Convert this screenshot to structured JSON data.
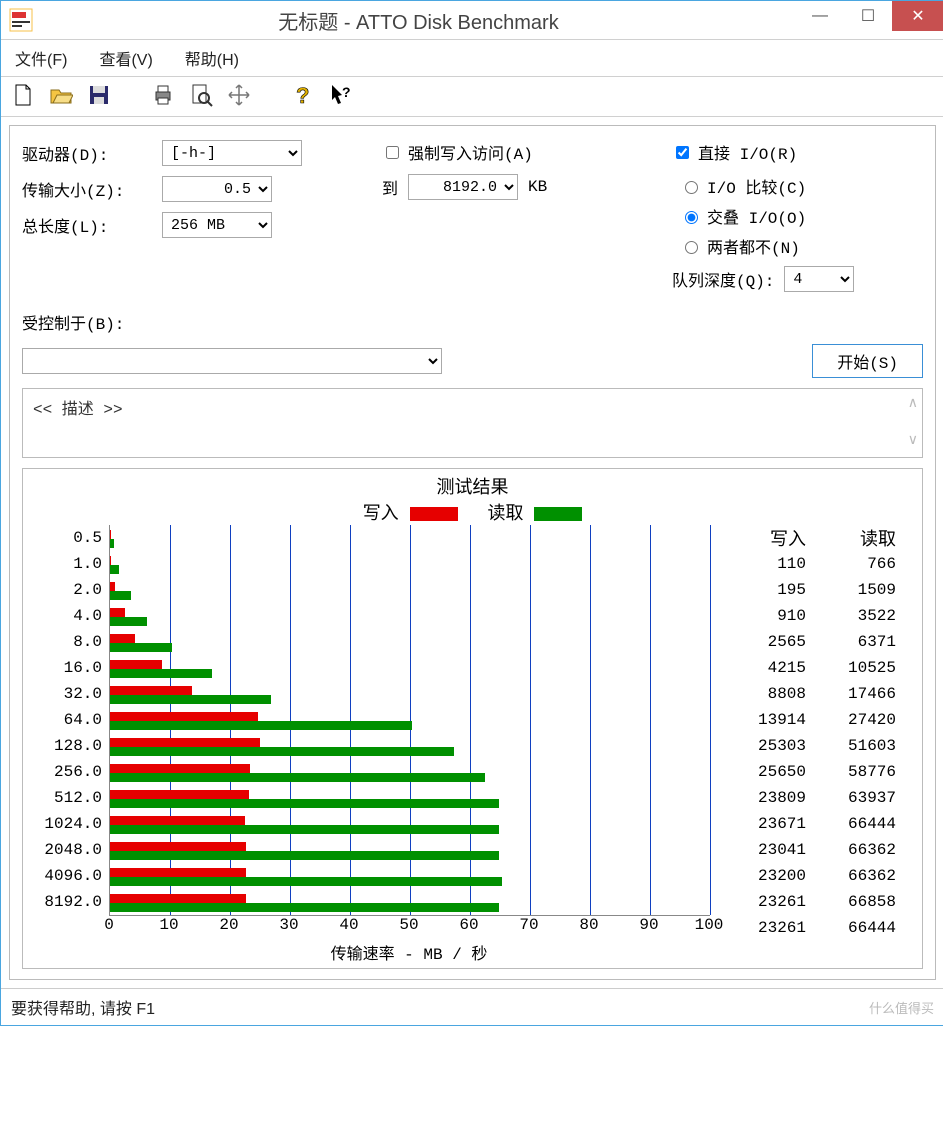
{
  "window": {
    "title": "无标题 - ATTO Disk Benchmark"
  },
  "menu": {
    "file": "文件(F)",
    "view": "查看(V)",
    "help": "帮助(H)"
  },
  "labels": {
    "drive": "驱动器(D):",
    "transfer": "传输大小(Z):",
    "to": "到",
    "kb": "KB",
    "totallen": "总长度(L):",
    "forcewrite": "强制写入访问(A)",
    "directio": "直接 I/O(R)",
    "iocompare": "I/O 比较(C)",
    "overlapio": "交叠 I/O(O)",
    "neither": "两者都不(N)",
    "qdepth": "队列深度(Q):",
    "controlled": "受控制于(B):",
    "start": "开始(S)",
    "desc": "<< 描述 >>"
  },
  "values": {
    "drive": "[-h-]",
    "tmin": "0.5",
    "tmax": "8192.0",
    "totallen": "256 MB",
    "qdepth": "4",
    "forcewrite": false,
    "directio": true,
    "iomode": "overlap"
  },
  "chart": {
    "title": "测试结果",
    "legend_write": "写入",
    "legend_read": "读取",
    "xlabel": "传输速率 - MB / 秒",
    "hdr_write": "写入",
    "hdr_read": "读取"
  },
  "chart_data": {
    "type": "bar",
    "xlabel": "传输速率 - MB / 秒",
    "xlim": [
      0,
      100
    ],
    "xticks": [
      0,
      10,
      20,
      30,
      40,
      50,
      60,
      70,
      80,
      90,
      100
    ],
    "categories": [
      "0.5",
      "1.0",
      "2.0",
      "4.0",
      "8.0",
      "16.0",
      "32.0",
      "64.0",
      "128.0",
      "256.0",
      "512.0",
      "1024.0",
      "2048.0",
      "4096.0",
      "8192.0"
    ],
    "series": [
      {
        "name": "写入",
        "unit": "KB/s",
        "values": [
          110,
          195,
          910,
          2565,
          4215,
          8808,
          13914,
          25303,
          25650,
          23809,
          23671,
          23041,
          23200,
          23261,
          23261
        ]
      },
      {
        "name": "读取",
        "unit": "KB/s",
        "values": [
          766,
          1509,
          3522,
          6371,
          10525,
          17466,
          27420,
          51603,
          58776,
          63937,
          66444,
          66362,
          66362,
          66858,
          66444
        ]
      }
    ]
  },
  "status": {
    "text": "要获得帮助, 请按 F1",
    "watermark": "什么值得买"
  }
}
